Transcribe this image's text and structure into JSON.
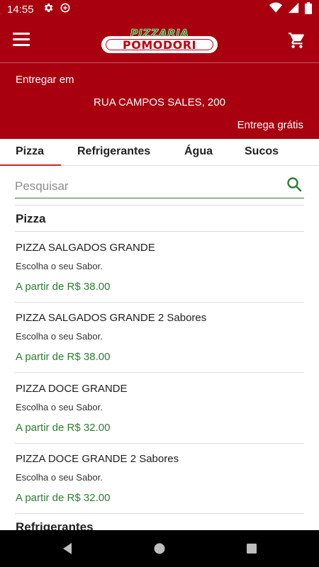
{
  "status_bar": {
    "time": "14:55",
    "icons": [
      "settings-icon",
      "data-saver-icon",
      "wifi-icon",
      "signal-icon",
      "battery-icon"
    ]
  },
  "app_bar": {
    "brand_top": "PIZZARIA",
    "brand_bottom": "POMODORI",
    "menu_icon": "hamburger-menu-icon",
    "cart_icon": "shopping-cart-icon"
  },
  "delivery": {
    "label": "Entregar em",
    "address": "RUA CAMPOS SALES, 200",
    "fee": "Entrega grátis"
  },
  "tabs": [
    {
      "label": "Pizza",
      "active": true
    },
    {
      "label": "Refrigerantes",
      "active": false
    },
    {
      "label": "Água",
      "active": false
    },
    {
      "label": "Sucos",
      "active": false
    }
  ],
  "search": {
    "placeholder": "Pesquisar",
    "value": ""
  },
  "sections": [
    {
      "title": "Pizza",
      "items": [
        {
          "name": "PIZZA SALGADOS GRANDE",
          "description": "Escolha o seu Sabor.",
          "price": "A partir de R$ 38.00"
        },
        {
          "name": "PIZZA SALGADOS GRANDE 2 Sabores",
          "description": "Escolha o seu Sabor.",
          "price": "A partir de R$ 38.00"
        },
        {
          "name": "PIZZA DOCE GRANDE",
          "description": "Escolha o seu Sabor.",
          "price": "A partir de R$ 32.00"
        },
        {
          "name": "PIZZA DOCE GRANDE 2 Sabores",
          "description": "Escolha o seu Sabor.",
          "price": "A partir de R$ 32.00"
        }
      ]
    },
    {
      "title": "Refrigerantes",
      "items": []
    }
  ],
  "colors": {
    "brand_red": "#a8000f",
    "price_green": "#2e7d32",
    "accent_green": "#1c8b1c"
  },
  "nav_bar": {
    "icons": [
      "back-icon",
      "home-icon",
      "recents-icon"
    ]
  }
}
